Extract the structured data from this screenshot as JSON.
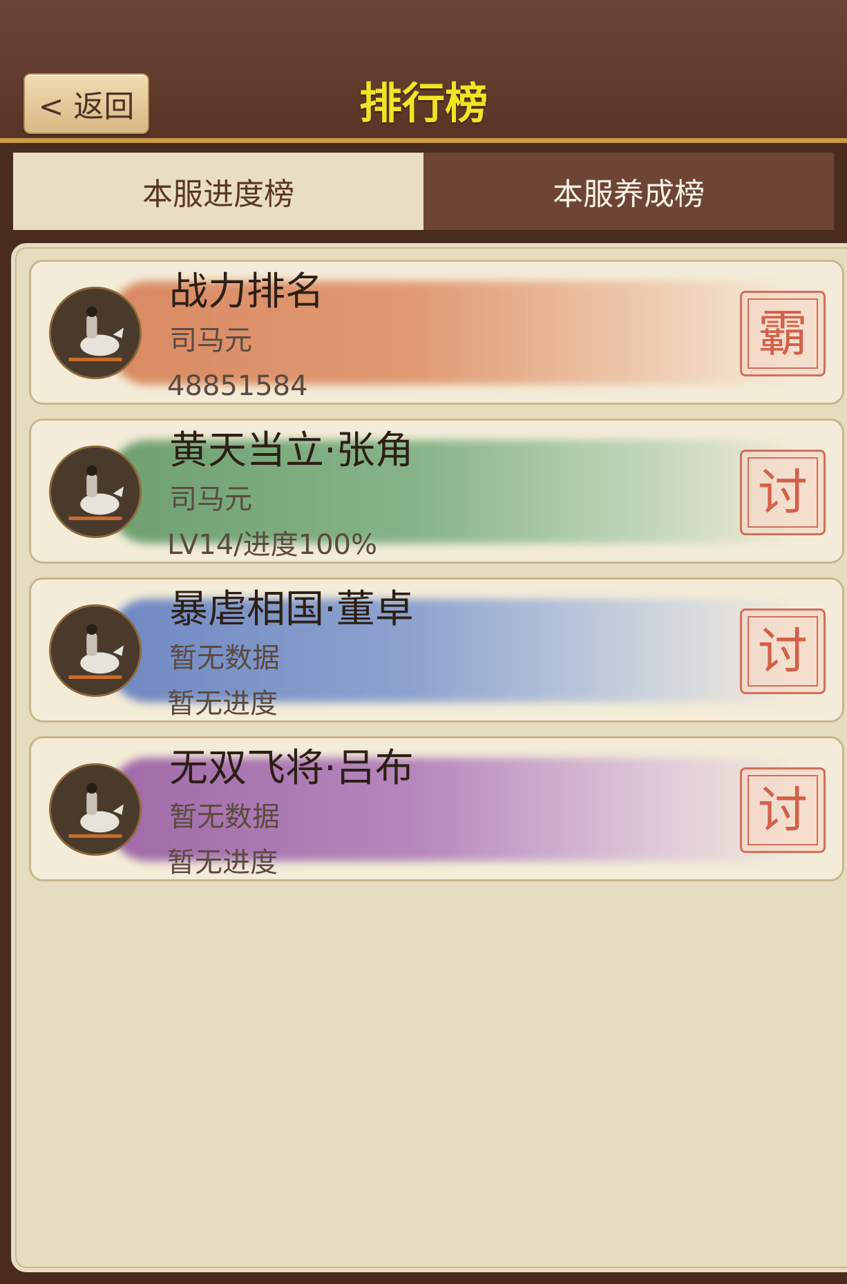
{
  "header": {
    "back_label": "< 返回",
    "title": "排行榜"
  },
  "tabs": [
    {
      "label": "本服进度榜",
      "active": true
    },
    {
      "label": "本服养成榜",
      "active": false
    }
  ],
  "cards": [
    {
      "title": "战力排名",
      "player": "司马元",
      "info": "48851584",
      "stamp": "霸",
      "brush_color": "#d98a62"
    },
    {
      "title": "黄天当立·张角",
      "player": "司马元",
      "info": "LV14/进度100%",
      "stamp": "讨",
      "brush_color": "#7fae7f"
    },
    {
      "title": "暴虐相国·董卓",
      "player": "暂无数据",
      "info": "暂无进度",
      "stamp": "讨",
      "brush_color": "#7f97c8"
    },
    {
      "title": "无双飞将·吕布",
      "player": "暂无数据",
      "info": "暂无进度",
      "stamp": "讨",
      "brush_color": "#ad7ab5"
    }
  ]
}
